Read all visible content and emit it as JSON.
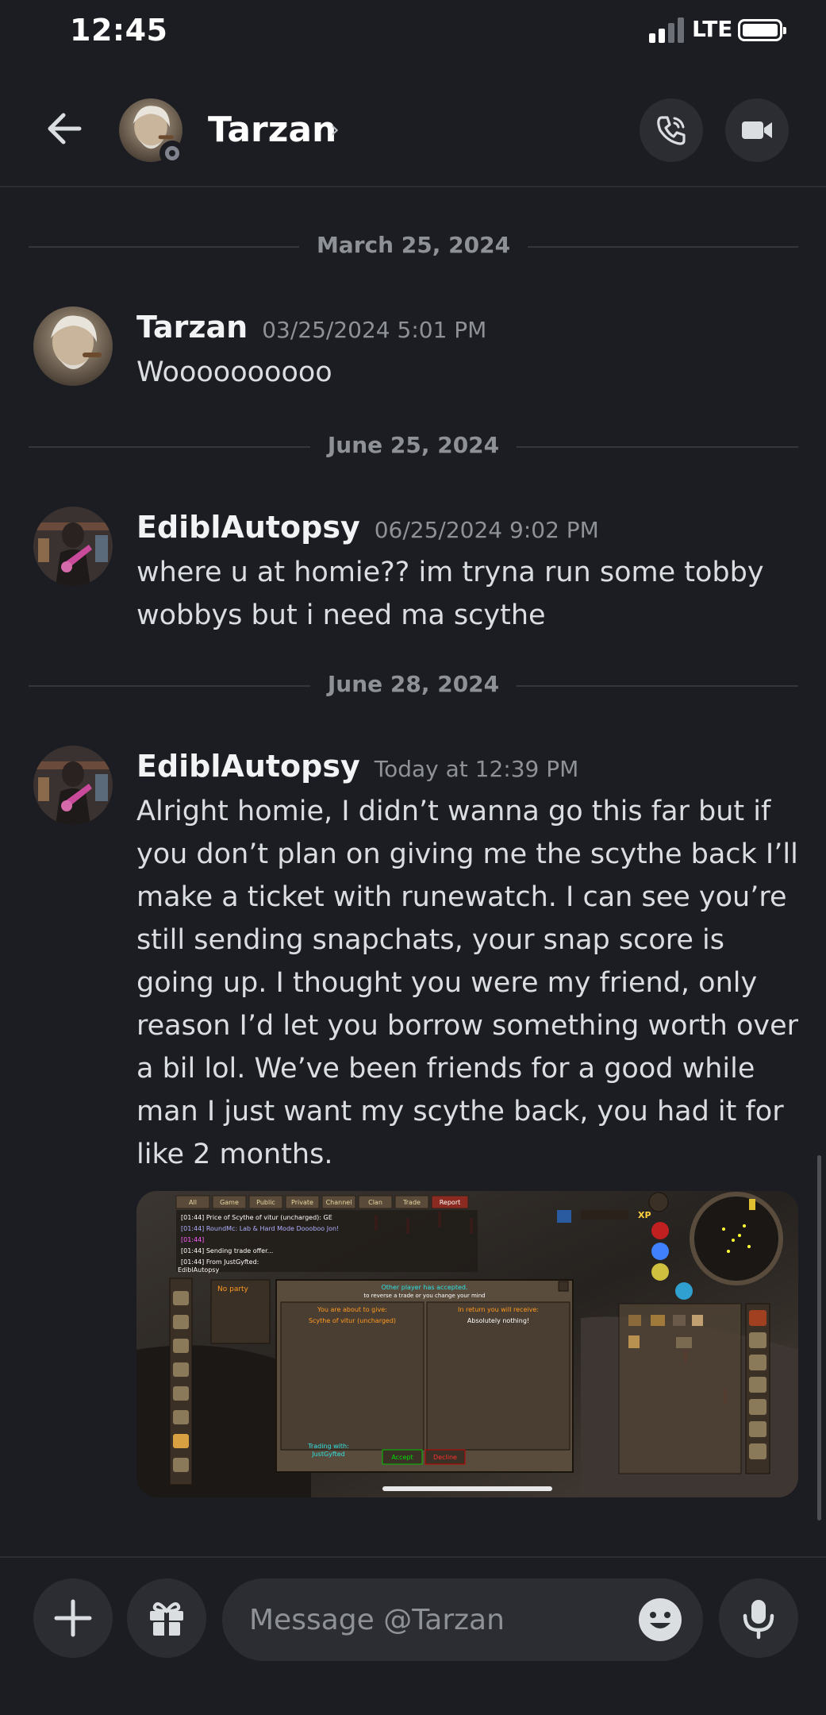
{
  "status_bar": {
    "time": "12:45",
    "network": "LTE",
    "icons": [
      "signal-icon",
      "battery-icon"
    ]
  },
  "header": {
    "back_icon": "arrow-left-icon",
    "name": "Tarzan",
    "chevron": "›",
    "presence": "offline",
    "buttons": [
      {
        "name": "voice-call-button",
        "icon": "phone-icon"
      },
      {
        "name": "video-call-button",
        "icon": "video-camera-icon"
      }
    ]
  },
  "dividers": [
    {
      "label": "March 25, 2024"
    },
    {
      "label": "June 25, 2024"
    },
    {
      "label": "June 28, 2024"
    }
  ],
  "messages": [
    {
      "author": "Tarzan",
      "timestamp": "03/25/2024 5:01 PM",
      "lines": [
        "Woooooooooo"
      ]
    },
    {
      "author": "EdiblAutopsy",
      "timestamp": "06/25/2024 9:02 PM",
      "lines": [
        "where u at homie?? im tryna run some tobby",
        "wobbys but i need ma scythe"
      ]
    },
    {
      "author": "EdiblAutopsy",
      "timestamp": "Today at 12:39 PM",
      "lines": [
        "Alright homie, I didn’t wanna go this far but if",
        "you don’t plan on giving me the scythe back I’ll",
        "make a ticket with runewatch. I can see you’re",
        "still sending snapchats, your snap score is",
        "going up. I thought you were my friend, only",
        "reason I’d let you borrow something worth over",
        "a bil lol. We’ve been friends for a good while",
        "man I just want my scythe back, you had it for",
        "like 2 months."
      ]
    }
  ],
  "attachment": {
    "kind": "game screenshot",
    "tabs": [
      "All",
      "Game",
      "Public",
      "Private",
      "Channel",
      "Clan",
      "Trade",
      "Report"
    ],
    "chat_lines": [
      "[01:44] Price of Scythe of vitur (uncharged): GE",
      "[01:44] RoundMc: Lab & Hard Mode Doooboo Jon!",
      "[01:44]",
      "[01:44] Sending trade offer...",
      "[01:44] From JustGyfted:"
    ],
    "chat_input": "EdiblAutopsy",
    "party": "No party",
    "trade_title": "Other player has accepted.",
    "trade_warning": "to reverse a trade or you change your mind",
    "you_give_label": "You are about to give:",
    "you_give_item": "Scythe of vitur (uncharged)",
    "you_receive_label": "In return you will receive:",
    "you_receive_item": "Absolutely nothing!",
    "trading_with_label": "Trading with:",
    "trading_with_name": "JustGyfted",
    "accept": "Accept",
    "decline": "Decline",
    "xp_label": "XP"
  },
  "composer": {
    "placeholder": "Message @Tarzan",
    "icons": [
      "plus-icon",
      "gift-icon",
      "emoji-icon",
      "microphone-icon"
    ]
  }
}
